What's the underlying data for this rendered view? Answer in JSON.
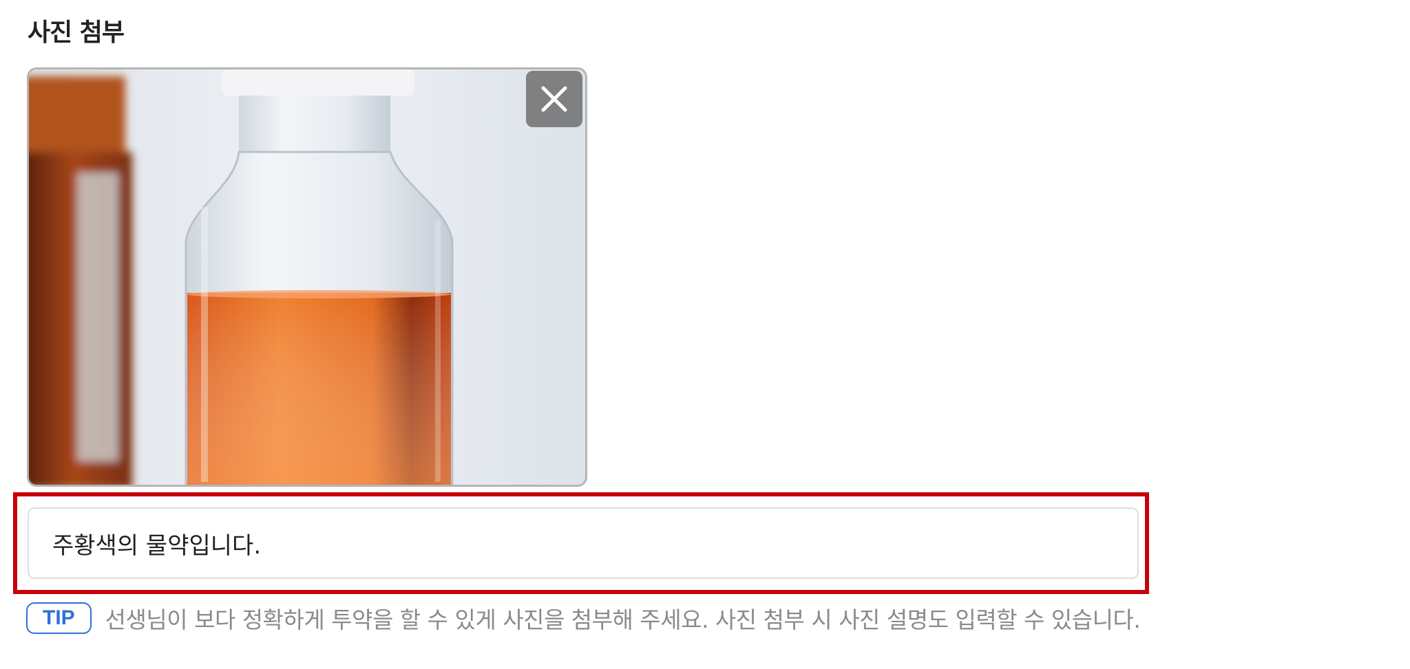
{
  "section": {
    "title": "사진 첨부"
  },
  "photo": {
    "remove_icon": "close-icon"
  },
  "caption": {
    "value": "주황색의 물약입니다."
  },
  "tip": {
    "badge": "TIP",
    "text": "선생님이 보다 정확하게 투약을 할 수 있게 사진을 첨부해 주세요. 사진 첨부 시 사진 설명도 입력할 수 있습니다."
  },
  "colors": {
    "highlight": "#c8000a",
    "accent": "#2f6fd8"
  }
}
